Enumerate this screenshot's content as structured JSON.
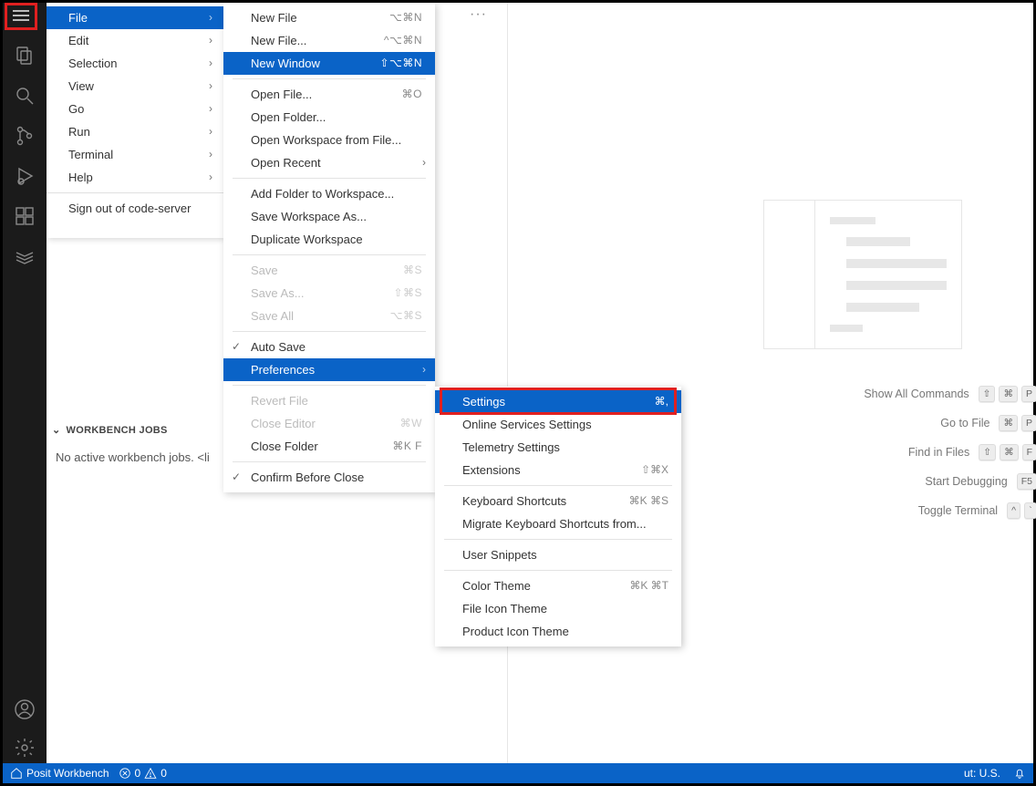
{
  "app_menu": {
    "items": [
      {
        "label": "File"
      },
      {
        "label": "Edit"
      },
      {
        "label": "Selection"
      },
      {
        "label": "View"
      },
      {
        "label": "Go"
      },
      {
        "label": "Run"
      },
      {
        "label": "Terminal"
      },
      {
        "label": "Help"
      }
    ],
    "sign_out": "Sign out of code-server"
  },
  "file_menu": {
    "g1": [
      {
        "label": "New File",
        "shortcut": "⌥⌘N"
      },
      {
        "label": "New File...",
        "shortcut": "^⌥⌘N"
      },
      {
        "label": "New Window",
        "shortcut": "⇧⌥⌘N",
        "sel": true
      }
    ],
    "g2": [
      {
        "label": "Open File...",
        "shortcut": "⌘O"
      },
      {
        "label": "Open Folder..."
      },
      {
        "label": "Open Workspace from File..."
      },
      {
        "label": "Open Recent",
        "submenu": true
      }
    ],
    "g3": [
      {
        "label": "Add Folder to Workspace..."
      },
      {
        "label": "Save Workspace As..."
      },
      {
        "label": "Duplicate Workspace"
      }
    ],
    "g4": [
      {
        "label": "Save",
        "shortcut": "⌘S",
        "disabled": true
      },
      {
        "label": "Save As...",
        "shortcut": "⇧⌘S",
        "disabled": true
      },
      {
        "label": "Save All",
        "shortcut": "⌥⌘S",
        "disabled": true
      }
    ],
    "g5": [
      {
        "label": "Auto Save",
        "checked": true
      },
      {
        "label": "Preferences",
        "submenu": true,
        "sel": true
      }
    ],
    "g6": [
      {
        "label": "Revert File",
        "disabled": true
      },
      {
        "label": "Close Editor",
        "shortcut": "⌘W",
        "disabled": true
      },
      {
        "label": "Close Folder",
        "shortcut": "⌘K F"
      }
    ],
    "g7": [
      {
        "label": "Confirm Before Close",
        "checked": true
      }
    ]
  },
  "pref_menu": {
    "g1": [
      {
        "label": "Settings",
        "shortcut": "⌘,",
        "sel": true
      },
      {
        "label": "Online Services Settings"
      },
      {
        "label": "Telemetry Settings"
      },
      {
        "label": "Extensions",
        "shortcut": "⇧⌘X"
      }
    ],
    "g2": [
      {
        "label": "Keyboard Shortcuts",
        "shortcut": "⌘K ⌘S"
      },
      {
        "label": "Migrate Keyboard Shortcuts from..."
      }
    ],
    "g3": [
      {
        "label": "User Snippets"
      }
    ],
    "g4": [
      {
        "label": "Color Theme",
        "shortcut": "⌘K ⌘T"
      },
      {
        "label": "File Icon Theme"
      },
      {
        "label": "Product Icon Theme"
      }
    ]
  },
  "jobs": {
    "header": "WORKBENCH JOBS",
    "body": "No active workbench jobs. <li"
  },
  "welcome_cmds": [
    {
      "label": "Show All Commands",
      "keys": [
        "⇧",
        "⌘",
        "P"
      ]
    },
    {
      "label": "Go to File",
      "keys": [
        "⌘",
        "P"
      ]
    },
    {
      "label": "Find in Files",
      "keys": [
        "⇧",
        "⌘",
        "F"
      ]
    },
    {
      "label": "Start Debugging",
      "keys": [
        "F5"
      ]
    },
    {
      "label": "Toggle Terminal",
      "keys": [
        "^",
        "`"
      ]
    }
  ],
  "status": {
    "home": "Posit Workbench",
    "errors": "0",
    "warnings": "0",
    "layout": "ut: U.S."
  },
  "tab_more": "···"
}
